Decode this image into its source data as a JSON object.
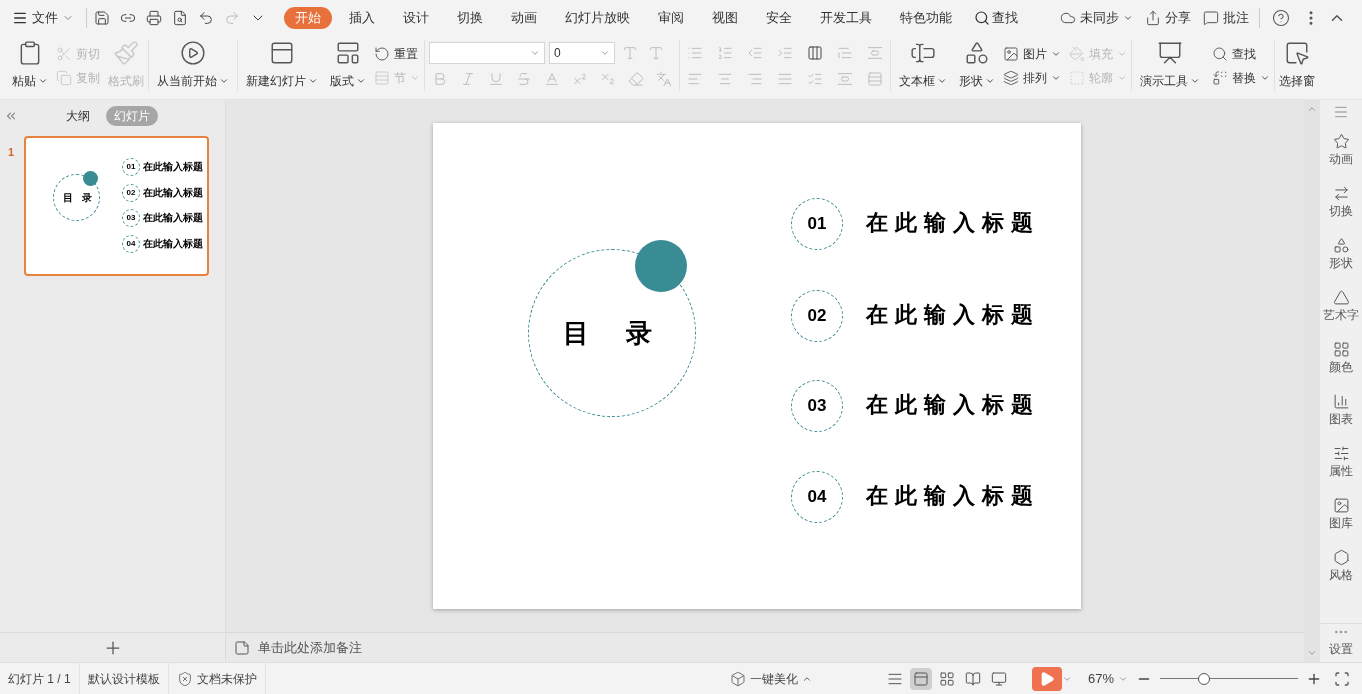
{
  "menu": {
    "label": "文件"
  },
  "tabs": [
    {
      "label": "开始",
      "selected": true
    },
    {
      "label": "插入",
      "selected": false
    },
    {
      "label": "设计",
      "selected": false
    },
    {
      "label": "切换",
      "selected": false
    },
    {
      "label": "动画",
      "selected": false
    },
    {
      "label": "幻灯片放映",
      "selected": false
    },
    {
      "label": "审阅",
      "selected": false
    },
    {
      "label": "视图",
      "selected": false
    },
    {
      "label": "安全",
      "selected": false
    },
    {
      "label": "开发工具",
      "selected": false
    },
    {
      "label": "特色功能",
      "selected": false
    }
  ],
  "search": {
    "label": "查找"
  },
  "title_actions": [
    {
      "label": "未同步"
    },
    {
      "label": "分享"
    },
    {
      "label": "批注"
    }
  ],
  "ribbon": {
    "paste": {
      "label": "粘贴",
      "disabled": false
    },
    "cut": {
      "label": "剪切",
      "disabled": true
    },
    "copy": {
      "label": "复制",
      "disabled": true
    },
    "format_painter": {
      "label": "格式刷",
      "disabled": true
    },
    "play_from_current": {
      "label": "从当前开始",
      "disabled": false
    },
    "new_slide": {
      "label": "新建幻灯片",
      "disabled": false
    },
    "layout": {
      "label": "版式",
      "disabled": false
    },
    "reset": {
      "label": "重置",
      "disabled": false
    },
    "section": {
      "label": "节",
      "disabled": true
    },
    "font_size": {
      "value": "0"
    },
    "font_format": {
      "disabled": true
    },
    "paragraph": {
      "disabled": true
    },
    "textbox": {
      "label": "文本框",
      "disabled": false
    },
    "shape": {
      "label": "形状",
      "disabled": false
    },
    "picture": {
      "label": "图片",
      "disabled": false
    },
    "fill": {
      "label": "填充",
      "disabled": true
    },
    "arrange": {
      "label": "排列",
      "disabled": false
    },
    "outline": {
      "label": "轮廓",
      "disabled": true
    },
    "presenter_tools": {
      "label": "演示工具",
      "disabled": false
    },
    "find": {
      "label": "查找",
      "disabled": false
    },
    "replace": {
      "label": "替换",
      "disabled": false
    },
    "selection_pane": {
      "label": "选择窗",
      "disabled": false
    }
  },
  "panel_tabs": [
    {
      "label": "大纲",
      "selected": false
    },
    {
      "label": "幻灯片",
      "selected": true
    }
  ],
  "thumbnails": [
    {
      "number": "1",
      "selected": true,
      "title": "目 录",
      "items": [
        {
          "number": "01",
          "title": "在此输入标题"
        },
        {
          "number": "02",
          "title": "在此输入标题"
        },
        {
          "number": "03",
          "title": "在此输入标题"
        },
        {
          "number": "04",
          "title": "在此输入标题"
        }
      ]
    }
  ],
  "slide": {
    "title": "目 录",
    "items": [
      {
        "number": "01",
        "title": "在此输入标题"
      },
      {
        "number": "02",
        "title": "在此输入标题"
      },
      {
        "number": "03",
        "title": "在此输入标题"
      },
      {
        "number": "04",
        "title": "在此输入标题"
      }
    ]
  },
  "notes": {
    "placeholder": "单击此处添加备注"
  },
  "side_tools": [
    {
      "label": "动画"
    },
    {
      "label": "切换"
    },
    {
      "label": "形状"
    },
    {
      "label": "艺术字"
    },
    {
      "label": "颜色"
    },
    {
      "label": "图表"
    },
    {
      "label": "属性"
    },
    {
      "label": "图库"
    },
    {
      "label": "风格"
    }
  ],
  "side_settings": {
    "label": "设置"
  },
  "status_bar": {
    "items": [
      {
        "label": "幻灯片 1 / 1"
      },
      {
        "label": "默认设计模板"
      },
      {
        "label": "文档未保护"
      }
    ],
    "beautify": {
      "label": "一键美化"
    },
    "views": [
      {
        "selected": false
      },
      {
        "selected": true
      },
      {
        "selected": false
      },
      {
        "selected": false
      },
      {
        "selected": false
      }
    ],
    "zoom": {
      "label": "67%",
      "level": 0.32
    }
  }
}
